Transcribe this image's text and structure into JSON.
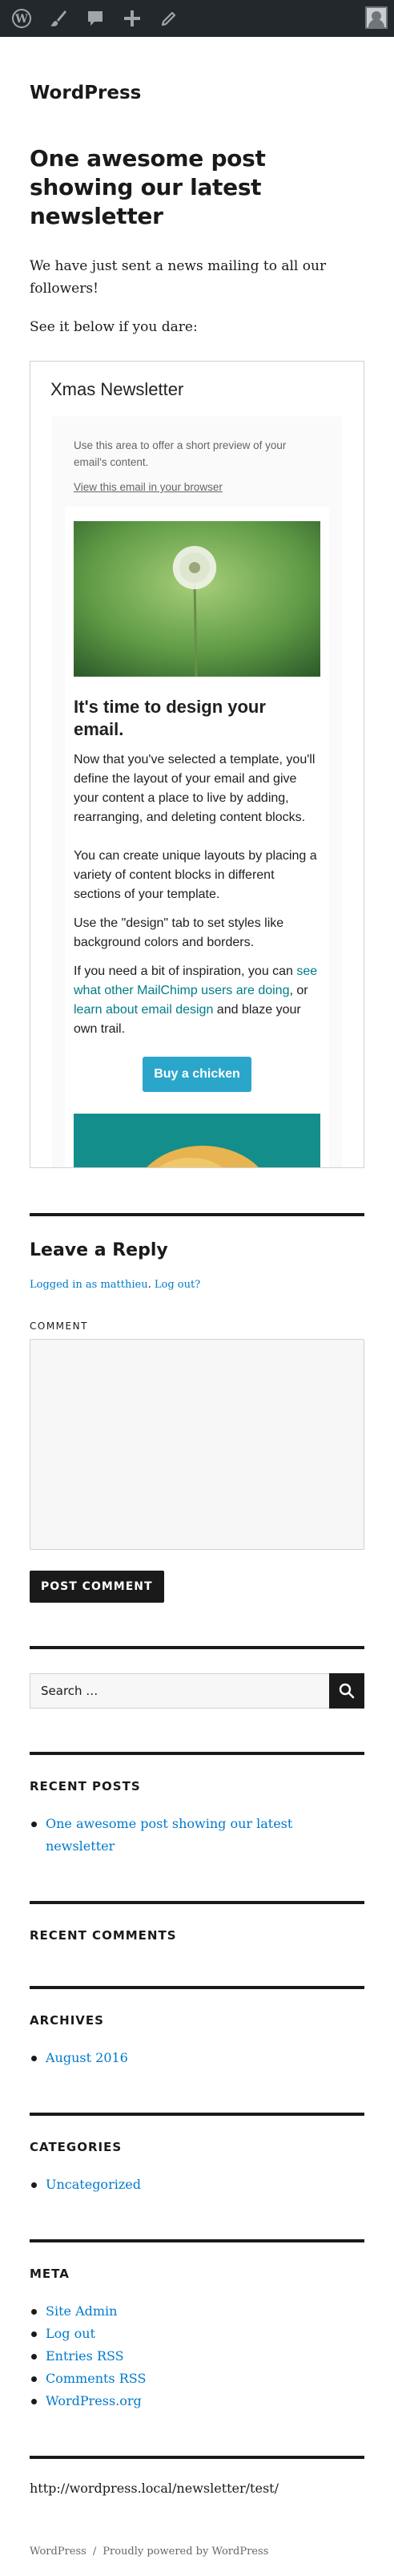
{
  "admin_bar": {
    "icons": [
      "wordpress-logo-icon",
      "customize-icon",
      "comments-icon",
      "new-content-icon",
      "edit-icon"
    ],
    "avatar": "user-avatar"
  },
  "site": {
    "title": "WordPress"
  },
  "post": {
    "title": "One awesome post showing our latest newsletter",
    "paragraphs": [
      "We have just sent a news mailing to all our followers!",
      "See it below if you dare:"
    ]
  },
  "newsletter": {
    "title": "Xmas Newsletter",
    "preheader_text": "Use this area to offer a short preview of your email's content.",
    "view_in_browser": "View this email in your browser",
    "heading": "It's time to design your email.",
    "p1": "Now that you've selected a template, you'll define the layout of your email and give your content a place to live by adding, rearranging, and deleting content blocks.",
    "p2": "You can create unique layouts by placing a variety of content blocks in different sections of your template.",
    "p3": "Use the \"design\" tab to set styles like background colors and borders.",
    "p4_before": "If you need a bit of inspiration, you can ",
    "p4_link1": "see what other MailChimp users are doing",
    "p4_mid": ", or ",
    "p4_link2": "learn about email design",
    "p4_after": " and blaze your own trail.",
    "button": "Buy a chicken"
  },
  "comments": {
    "title": "Leave a Reply",
    "logged_in_link": "Logged in as matthieu",
    "separator": ". ",
    "logout_link": "Log out?",
    "comment_label": "COMMENT",
    "submit": "POST COMMENT"
  },
  "search": {
    "placeholder": "Search …"
  },
  "widgets": {
    "recent_posts_title": "RECENT POSTS",
    "recent_posts": [
      "One awesome post showing our latest newsletter"
    ],
    "recent_comments_title": "RECENT COMMENTS",
    "archives_title": "ARCHIVES",
    "archives": [
      "August 2016"
    ],
    "categories_title": "CATEGORIES",
    "categories": [
      "Uncategorized"
    ],
    "meta_title": "META",
    "meta": [
      "Site Admin",
      "Log out",
      "Entries RSS",
      "Comments RSS",
      "WordPress.org"
    ]
  },
  "status_url": "http://wordpress.local/newsletter/test/",
  "footer": {
    "site": "WordPress",
    "sep": "/",
    "powered": "Proudly powered by WordPress"
  },
  "colors": {
    "admin_bar": "#23282d",
    "link": "#007acc",
    "button": "#2ba6cb",
    "text": "#1a1a1a"
  }
}
